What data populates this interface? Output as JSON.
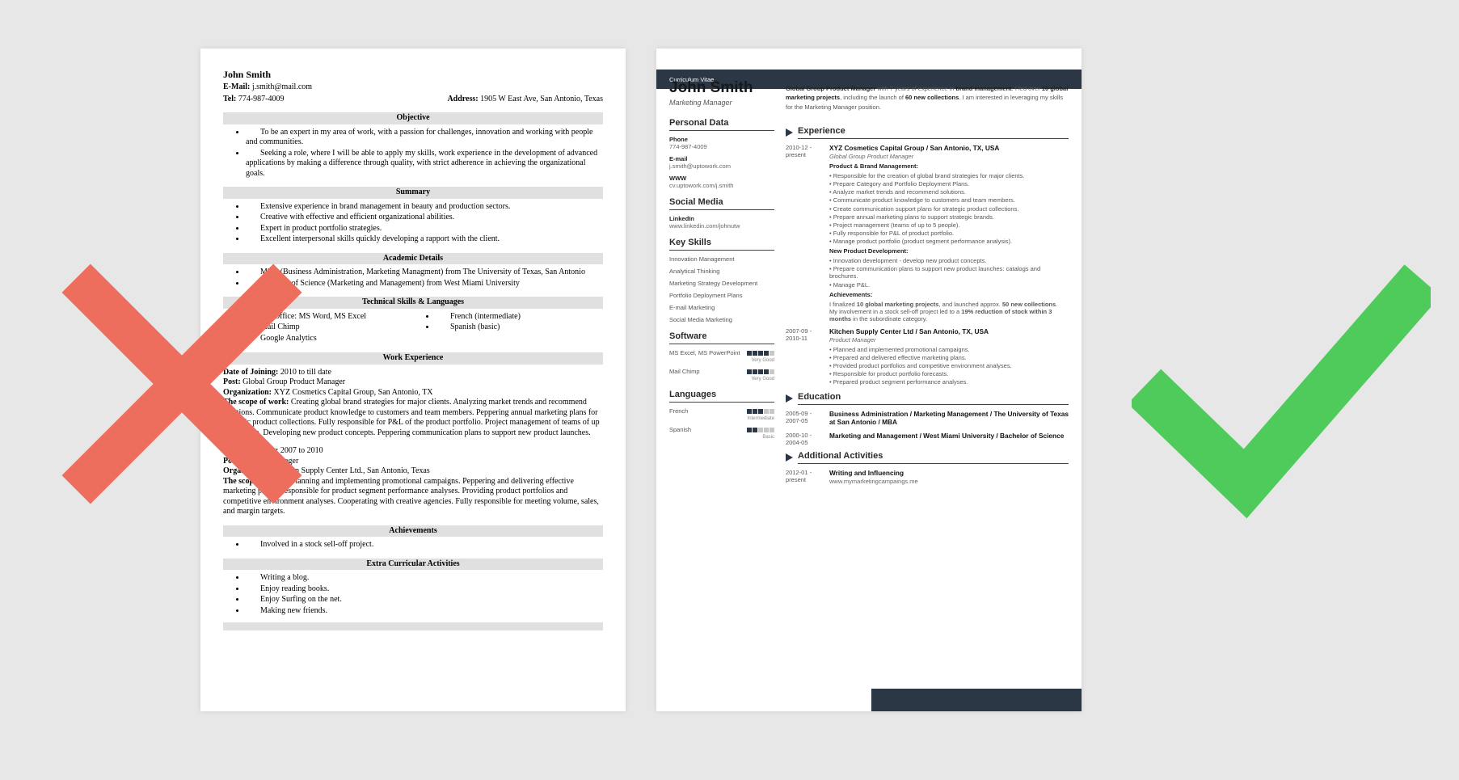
{
  "left": {
    "name": "John Smith",
    "email_label": "E-Mail:",
    "email": "j.smith@mail.com",
    "tel_label": "Tel:",
    "tel": "774-987-4009",
    "address_label": "Address:",
    "address": "1905 W East Ave, San Antonio, Texas",
    "sections": {
      "objective": "Objective",
      "summary": "Summary",
      "academic": "Academic Details",
      "skills": "Technical Skills & Languages",
      "work": "Work Experience",
      "achievements": "Achievements",
      "extra": "Extra Curricular Activities"
    },
    "objective_items": [
      "To be an expert in my area of work, with a passion for challenges, innovation and working with people and communities.",
      "Seeking a role, where I will be able to apply my skills, work experience in the development of advanced applications by making a difference through quality, with strict adherence in achieving the organizational goals."
    ],
    "summary_items": [
      "Extensive experience in brand management in beauty and production sectors.",
      "Creative with effective and efficient organizational abilities.",
      "Expert in product portfolio strategies.",
      "Excellent interpersonal skills quickly developing a rapport with the client."
    ],
    "academic_items": [
      "MBA (Business Administration, Marketing Managment) from The University of Texas, San Antonio",
      "Bachelor of Science (Marketing and Management) from West Miami University"
    ],
    "tech_skills": [
      "MS Office: MS Word, MS Excel",
      "Mail Chimp",
      "Google Analytics"
    ],
    "lang_skills": [
      "French (intermediate)",
      "Spanish (basic)"
    ],
    "job1": {
      "doj_label": "Date of Joining:",
      "doj": "2010 to till date",
      "post_label": "Post:",
      "post": "Global Group Product Manager",
      "org_label": "Organization:",
      "org": "XYZ Cosmetics Capital Group, San Antonio, TX",
      "scope_label": "The scope of work:",
      "scope": "Creating global brand strategies for major clients. Analyzing market trends and recommend solutions. Communicate product knowledge to customers and team members. Peppering annual marketing plans for strategic product collections. Fully responsible for P&L of the product portfolio. Project management of teams of up to 5 people. Developing new product concepts. Peppering communication plans  to support new product launches."
    },
    "job2": {
      "doj_label": "Date of Joining:",
      "doj": "2007 to 2010",
      "post_label": "Post:",
      "post": "Product Manager",
      "org_label": "Organization:",
      "org": "Kitchen Supply Center Ltd., San Antonio, Texas",
      "scope_label": "The scope of work:",
      "scope": "Planning and implementing promotional campaigns. Peppering and delivering effective marketing plans. Responsible for product segment performance analyses. Providing product portfolios and competitive environment analyses. Cooperating with creative agencies. Fully responsible for meeting volume, sales, and margin targets."
    },
    "achievements_items": [
      "Involved in a stock sell-off project."
    ],
    "extra_items": [
      "Writing a blog.",
      "Enjoy reading books.",
      "Enjoy Surfing on the net.",
      "Making new friends."
    ]
  },
  "right": {
    "cv_label": "Curriculum Vitae",
    "name": "John Smith",
    "title": "Marketing Manager",
    "summary_parts": {
      "a": "Global Group Product Manager",
      "b": " with 7 years of experience in ",
      "c": "brand management",
      "d": ". I led over ",
      "e": "10 global marketing projects",
      "f": ", including the launch of ",
      "g": "60 new collections",
      "h": ". I am interested in leveraging my skills for the Marketing Manager position."
    },
    "side_heads": {
      "personal": "Personal Data",
      "social": "Social Media",
      "keyskills": "Key Skills",
      "software": "Software",
      "languages": "Languages"
    },
    "personal": [
      {
        "k": "Phone",
        "v": "774-987-4009"
      },
      {
        "k": "E-mail",
        "v": "j.smith@uptowork.com"
      },
      {
        "k": "WWW",
        "v": "cv.uptowork.com/j.smith"
      }
    ],
    "social": [
      {
        "k": "LinkedIn",
        "v": "www.linkedin.com/johnutw"
      }
    ],
    "skills": [
      "Innovation Management",
      "Analytical Thinking",
      "Marketing Strategy Development",
      "Portfolio Deployment Plans",
      "E-mail Marketing",
      "Social Media Marketing"
    ],
    "software": [
      {
        "name": "MS Excel, MS PowerPoint",
        "score": 4,
        "label": "Very Good"
      },
      {
        "name": "Mail Chimp",
        "score": 4,
        "label": "Very Good"
      }
    ],
    "languages": [
      {
        "name": "French",
        "score": 3,
        "label": "Intermediate"
      },
      {
        "name": "Spanish",
        "score": 2,
        "label": "Basic"
      }
    ],
    "main_heads": {
      "experience": "Experience",
      "education": "Education",
      "activities": "Additional Activities"
    },
    "exp1": {
      "dates": "2010-12 - present",
      "title": "XYZ Cosmetics Capital Group / San Antonio, TX, USA",
      "role": "Global Group Product Manager",
      "group1": "Product & Brand Management:",
      "bullets1": [
        "Responsible for the creation of global brand strategies for major clients.",
        "Prepare Category and Portfolio Deployment Plans.",
        "Analyze market trends and recommend solutions.",
        "Communicate product knowledge to customers and team members.",
        "Create communication support plans for strategic product collections.",
        "Prepare annual marketing plans to support strategic brands.",
        "Project management (teams of up to 5 people).",
        "Fully responsible for P&L of product portfolio.",
        "Manage product portfolio (product segment performance analysis)."
      ],
      "group2": "New Product Development:",
      "bullets2": [
        "Innovation development - develop new product concepts.",
        "Prepare communication plans to support new product launches: catalogs and brochures.",
        "Manage P&L."
      ],
      "group3": "Achievements:",
      "ach_a": "I finalized ",
      "ach_b": "10 global marketing projects",
      "ach_c": ", and launched approx. ",
      "ach_d": "50 new collections",
      "ach_e": ".",
      "ach2_a": "My involvement in a stock sell-off project led to a ",
      "ach2_b": "19% reduction of stock within 3 months",
      "ach2_c": " in the subordinate category."
    },
    "exp2": {
      "dates": "2007-09 - 2010-11",
      "title": "Kitchen Supply Center Ltd / San Antonio, TX, USA",
      "role": "Product Manager",
      "bullets": [
        "Planned and implemented promotional campaigns.",
        "Prepared and delivered effective marketing plans.",
        "Provided product portfolios and competitive environment analyses.",
        "Responsible for product portfolio forecasts.",
        "Prepared product segment performance analyses."
      ]
    },
    "edu": [
      {
        "dates": "2005-09 - 2007-05",
        "title": "Business Administration / Marketing Management / The University of Texas at San Antonio / MBA"
      },
      {
        "dates": "2000-10 - 2004-05",
        "title": "Marketing and Management / West Miami University / Bachelor of Science"
      }
    ],
    "activities": [
      {
        "dates": "2012-01 - present",
        "title": "Writing and Influencing",
        "sub": "www.mymarketingcampaings.me"
      }
    ]
  }
}
